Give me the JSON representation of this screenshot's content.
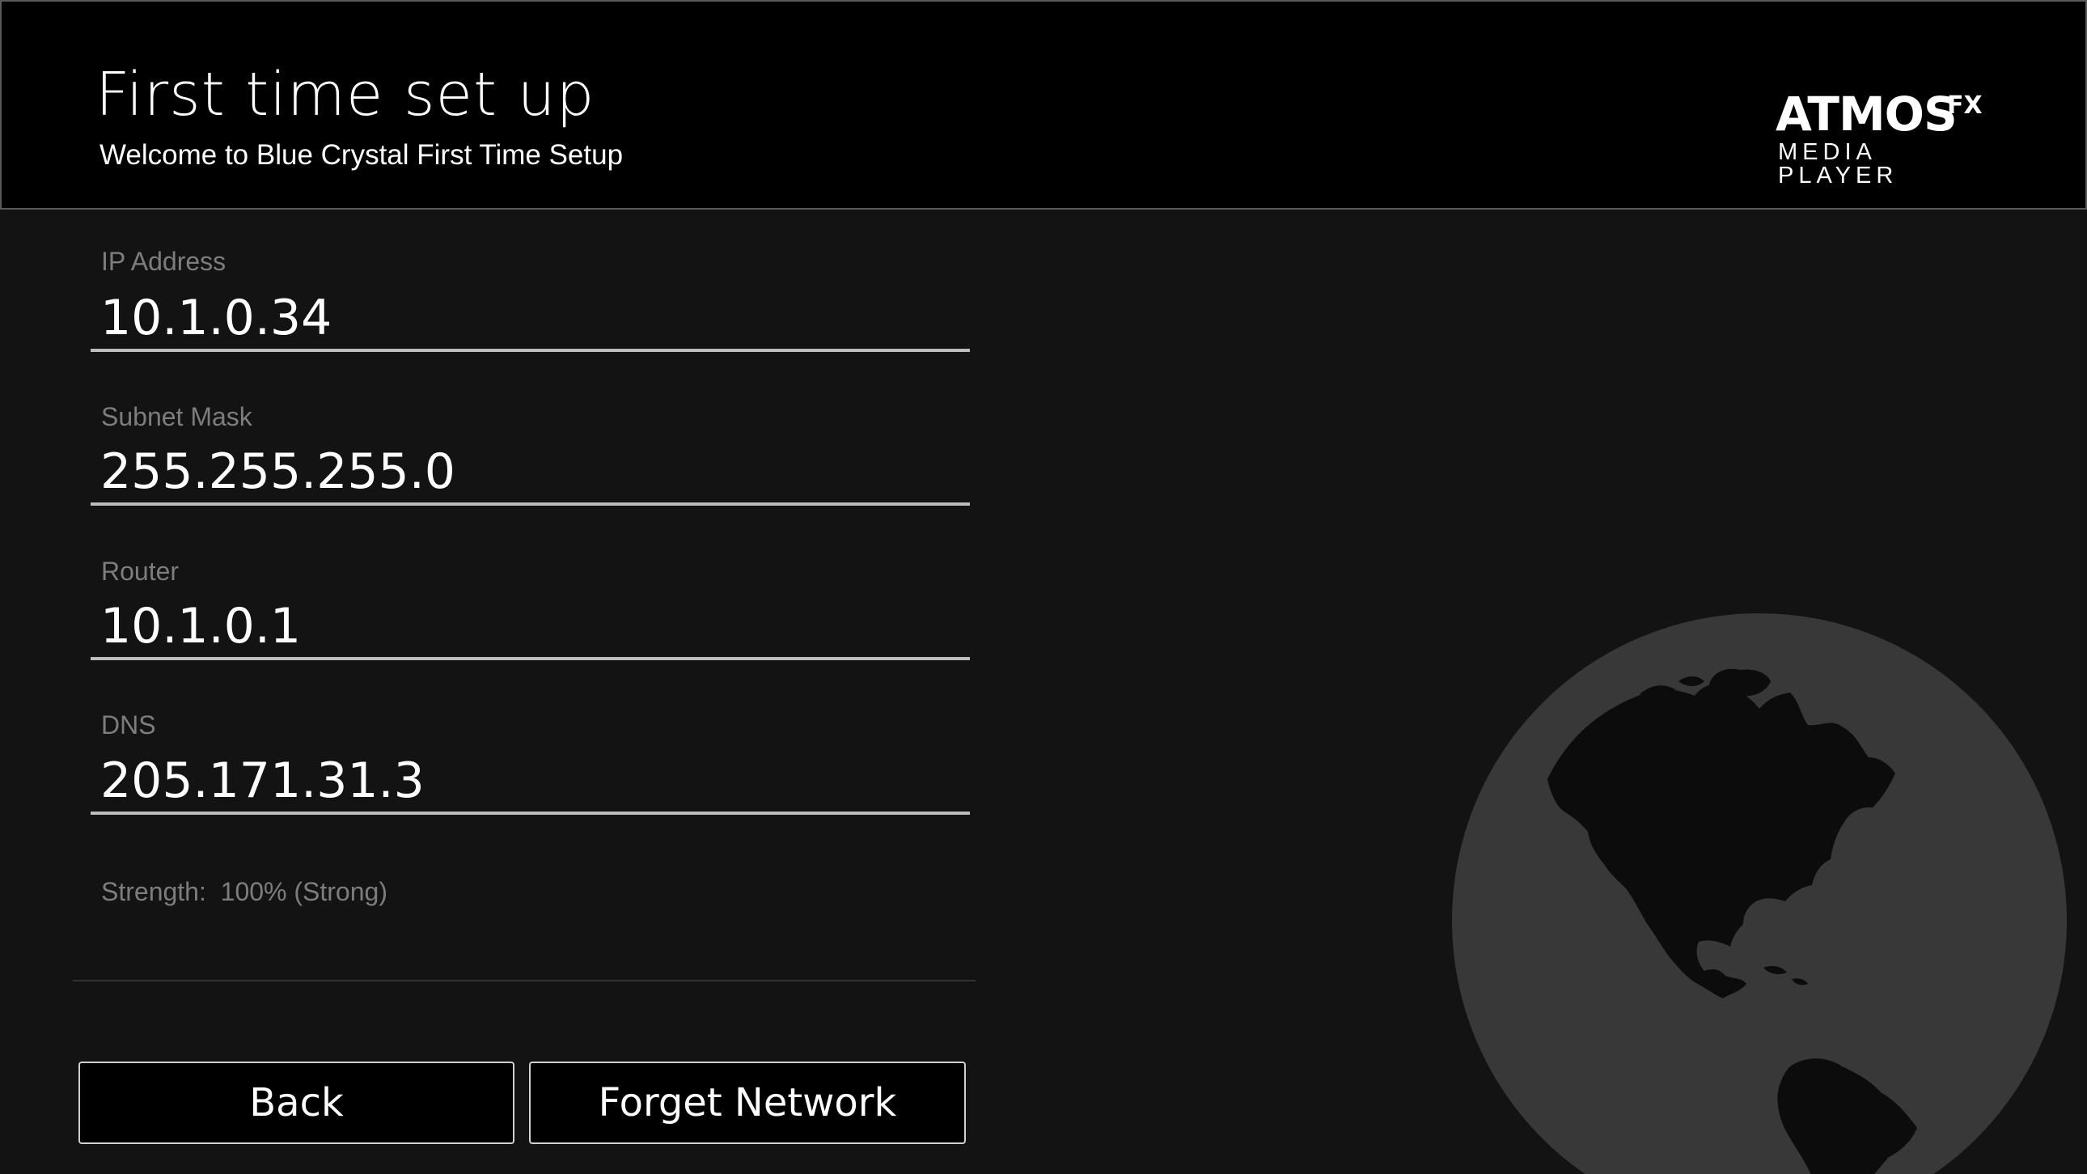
{
  "header": {
    "title": "First time set up",
    "subtitle": "Welcome to Blue Crystal First Time Setup",
    "logo": {
      "main": "ATMOS",
      "sup": "FX",
      "sub": "MEDIA PLAYER"
    }
  },
  "fields": [
    {
      "label": "IP Address",
      "value": "10.1.0.34"
    },
    {
      "label": "Subnet Mask",
      "value": "255.255.255.0"
    },
    {
      "label": "Router",
      "value": "10.1.0.1"
    },
    {
      "label": "DNS",
      "value": "205.171.31.3"
    }
  ],
  "strength": "Strength:  100% (Strong)",
  "buttons": {
    "back": "Back",
    "forget": "Forget Network"
  },
  "decor": {
    "globe_icon": "globe-americas-icon"
  },
  "colors": {
    "background": "#131313",
    "header_background": "#000000",
    "label_gray": "#7d7d7d",
    "underline": "#bdbdbd",
    "globe": "#383838",
    "land": "#0c0c0c"
  }
}
